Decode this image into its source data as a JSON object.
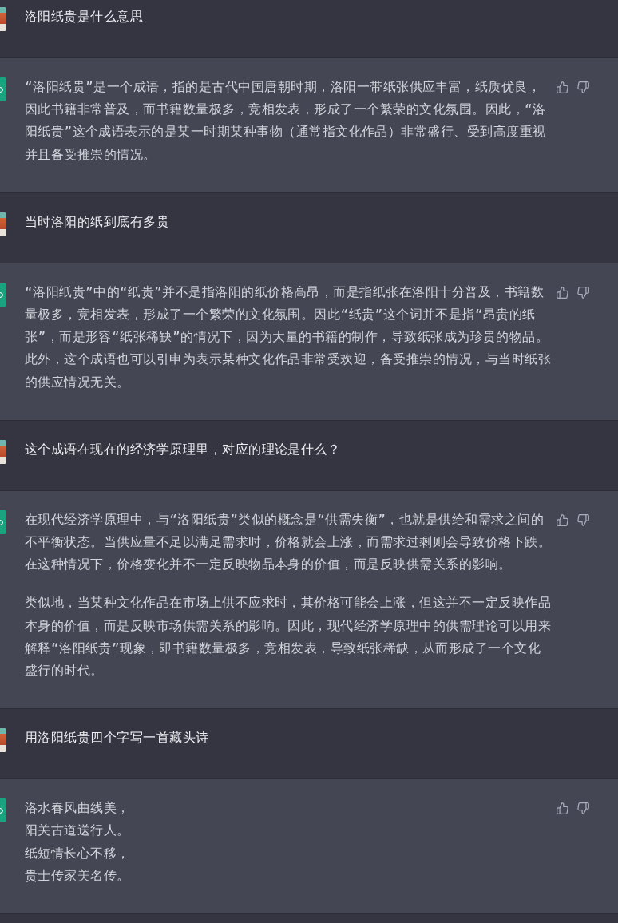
{
  "messages": [
    {
      "kind": "user",
      "paragraphs": [
        {
          "lines": [
            "洛阳纸贵是什么意思"
          ]
        }
      ]
    },
    {
      "kind": "assistant",
      "paragraphs": [
        {
          "lines": [
            "“洛阳纸贵”是一个成语，指的是古代中国唐朝时期，洛阳一带纸张供应丰富，纸质优良，因此书籍非常普及，而书籍数量极多，竞相发表，形成了一个繁荣的文化氛围。因此，“洛阳纸贵”这个成语表示的是某一时期某种事物（通常指文化作品）非常盛行、受到高度重视并且备受推崇的情况。"
          ]
        }
      ]
    },
    {
      "kind": "user",
      "paragraphs": [
        {
          "lines": [
            "当时洛阳的纸到底有多贵"
          ]
        }
      ]
    },
    {
      "kind": "assistant",
      "paragraphs": [
        {
          "lines": [
            "“洛阳纸贵”中的“纸贵”并不是指洛阳的纸价格高昂，而是指纸张在洛阳十分普及，书籍数量极多，竞相发表，形成了一个繁荣的文化氛围。因此“纸贵”这个词并不是指“昂贵的纸张”，而是形容“纸张稀缺”的情况下，因为大量的书籍的制作，导致纸张成为珍贵的物品。此外，这个成语也可以引申为表示某种文化作品非常受欢迎，备受推崇的情况，与当时纸张的供应情况无关。"
          ]
        }
      ]
    },
    {
      "kind": "user",
      "paragraphs": [
        {
          "lines": [
            "这个成语在现在的经济学原理里，对应的理论是什么？"
          ]
        }
      ]
    },
    {
      "kind": "assistant",
      "paragraphs": [
        {
          "lines": [
            "在现代经济学原理中，与“洛阳纸贵”类似的概念是“供需失衡”，也就是供给和需求之间的不平衡状态。当供应量不足以满足需求时，价格就会上涨，而需求过剩则会导致价格下跌。在这种情况下，价格变化并不一定反映物品本身的价值，而是反映供需关系的影响。"
          ]
        },
        {
          "lines": [
            "类似地，当某种文化作品在市场上供不应求时，其价格可能会上涨，但这并不一定反映作品本身的价值，而是反映市场供需关系的影响。因此，现代经济学原理中的供需理论可以用来解释“洛阳纸贵”现象，即书籍数量极多，竞相发表，导致纸张稀缺，从而形成了一个文化盛行的时代。"
          ]
        }
      ]
    },
    {
      "kind": "user",
      "paragraphs": [
        {
          "lines": [
            "用洛阳纸贵四个字写一首藏头诗"
          ]
        }
      ]
    },
    {
      "kind": "assistant",
      "paragraphs": [
        {
          "lines": [
            "洛水春风曲线美，",
            "阳关古道送行人。",
            "纸短情长心不移，",
            "贵士传家美名传。"
          ]
        }
      ]
    }
  ]
}
